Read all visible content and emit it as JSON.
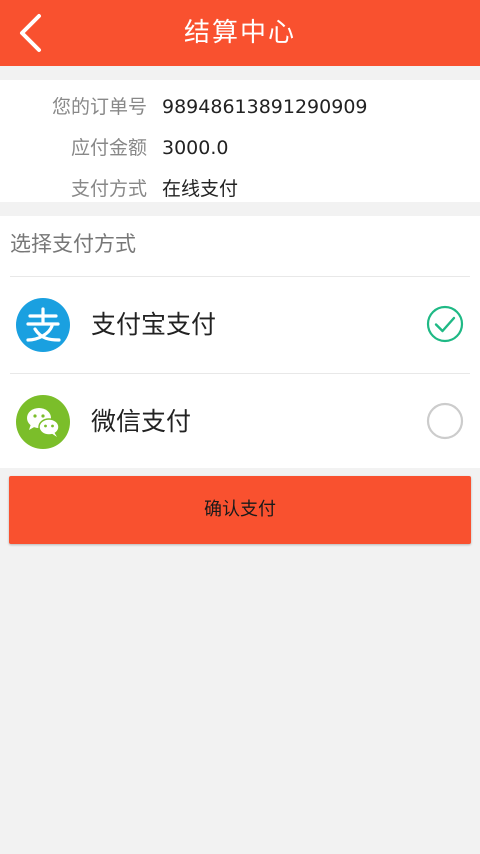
{
  "header": {
    "title": "结算中心",
    "back_icon": "chevron-left-icon",
    "color": "#f9512f"
  },
  "order": {
    "number_label": "您的订单号",
    "number": "98948613891290909",
    "amount_label": "应付金额",
    "amount": "3000.0",
    "method_label": "支付方式",
    "method": "在线支付"
  },
  "payment": {
    "section_title": "选择支付方式",
    "options": [
      {
        "label": "支付宝支付",
        "icon": "alipay-icon",
        "icon_color": "#1aa0e0",
        "selected": true
      },
      {
        "label": "微信支付",
        "icon": "wechat-icon",
        "icon_color": "#7bbe2a",
        "selected": false
      }
    ],
    "check_color": "#1fb985"
  },
  "confirm_label": "确认支付"
}
